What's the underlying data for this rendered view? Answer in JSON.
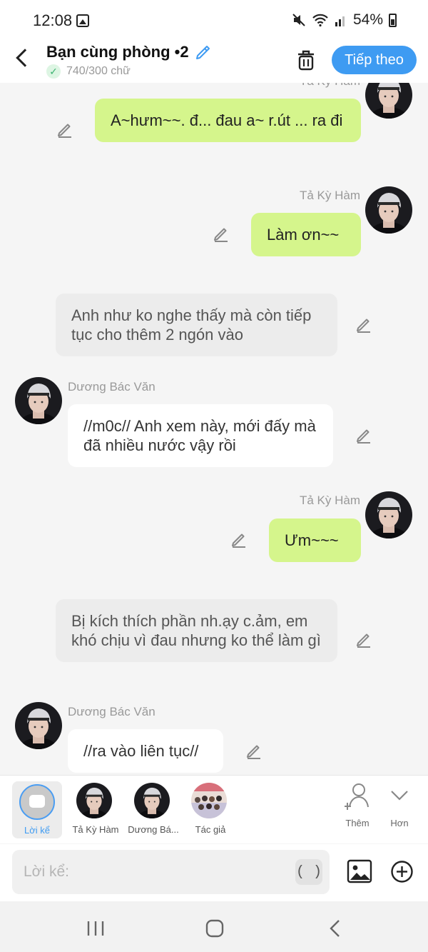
{
  "status_bar": {
    "time": "12:08",
    "battery": "54%"
  },
  "header": {
    "title": "Bạn cùng phòng •2",
    "word_count": "740/300 chữ",
    "next_label": "Tiếp theo"
  },
  "messages": [
    {
      "side": "right",
      "sender": "Tả Kỳ Hàm",
      "text": "A~hưm~~. đ... đau a~ r.út ... ra đi",
      "style": "green"
    },
    {
      "side": "right",
      "sender": "Tả Kỳ Hàm",
      "text": "Làm ơn~~",
      "style": "green"
    },
    {
      "side": "narration",
      "text": "Anh như ko nghe thấy mà còn tiếp tục cho thêm 2 ngón vào",
      "style": "grey"
    },
    {
      "side": "left",
      "sender": "Dương Bác Văn",
      "text": "//m0c// Anh xem này, mới đấy mà đã nhiều nước vậy rồi",
      "style": "white"
    },
    {
      "side": "right",
      "sender": "Tả Kỳ Hàm",
      "text": "Ưm~~~",
      "style": "green"
    },
    {
      "side": "narration",
      "text": "Bị kích thích phần nh.ạy c.ảm, em khó chịu vì đau nhưng ko thể làm gì",
      "style": "grey"
    },
    {
      "side": "left",
      "sender": "Dương Bác Văn",
      "text": "//ra vào liên tục//",
      "style": "white"
    }
  ],
  "characters": [
    {
      "label": "Lời kể",
      "selected": true
    },
    {
      "label": "Tả Kỳ Hàm"
    },
    {
      "label": "Dương Bá..."
    },
    {
      "label": "Tác giả"
    }
  ],
  "actions": {
    "add_label": "Thêm",
    "more_label": "Hơn"
  },
  "input": {
    "placeholder": "Lời kể:",
    "paren_label": "( )"
  },
  "colors": {
    "accent": "#3e9bf2",
    "green_bubble": "#d5f58c",
    "grey_bubble": "#ececec"
  }
}
